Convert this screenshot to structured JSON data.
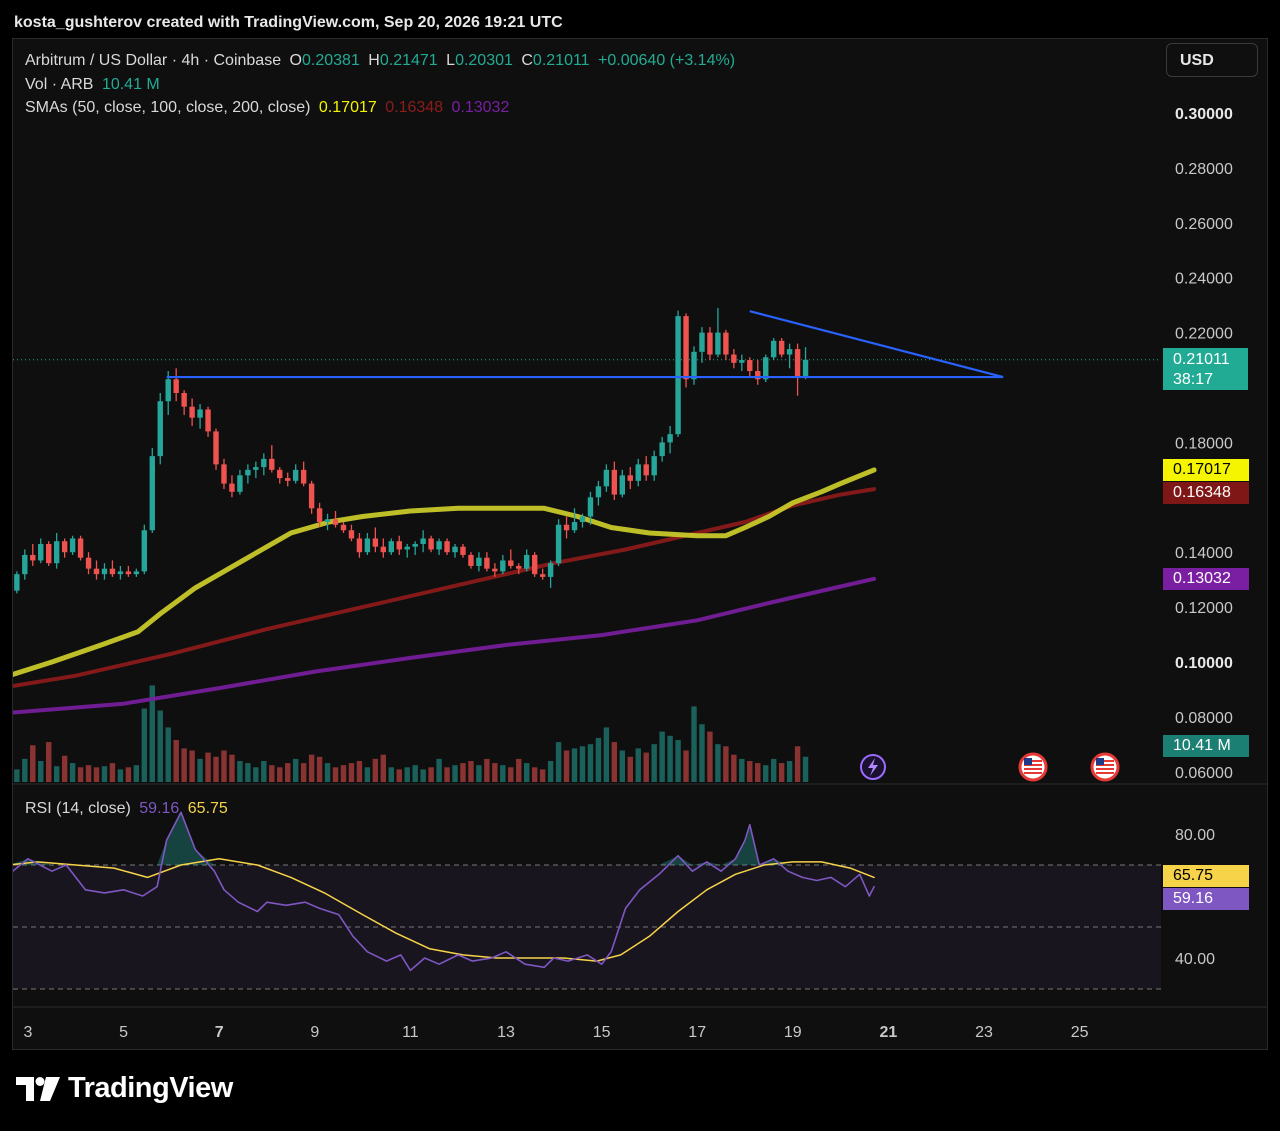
{
  "header": {
    "attribution": "kosta_gushterov created with TradingView.com, Sep 20, 2026 19:21 UTC"
  },
  "legend": {
    "symbol": "Arbitrum / US Dollar · 4h · Coinbase",
    "o_label": "O",
    "o_value": "0.20381",
    "h_label": "H",
    "h_value": "0.21471",
    "l_label": "L",
    "l_value": "0.20301",
    "c_label": "C",
    "c_value": "0.21011",
    "change": "+0.00640 (+3.14%)",
    "vol_label": "Vol · ARB",
    "vol_value": "10.41 M",
    "sma_label": "SMAs (50, close, 100, close, 200, close)",
    "sma50_value": "0.17017",
    "sma100_value": "0.16348",
    "sma200_value": "0.13032",
    "rsi_label": "RSI (14, close)",
    "rsi_value": "59.16",
    "rsi_ma_value": "65.75"
  },
  "toolbar": {
    "currency_label": "USD"
  },
  "price_badges": {
    "last_price": "0.21011",
    "countdown": "38:17",
    "sma50": "0.17017",
    "sma100": "0.16348",
    "sma200": "0.13032",
    "volume": "10.41 M",
    "rsi_ma": "65.75",
    "rsi": "59.16"
  },
  "icons": {
    "flash": "lightning-bolt-icon",
    "flag1": "us-flag-icon",
    "flag2": "us-flag-icon"
  },
  "colors": {
    "up": "#26a69a",
    "down": "#ef5350",
    "sma50": "#e6e600",
    "sma100": "#8b1a1a",
    "sma200": "#7b1fa2",
    "trendline": "#2962ff",
    "rsi": "#7e57c2",
    "rsi_ma": "#f7d34a"
  },
  "branding": {
    "logo_text": "TradingView"
  },
  "chart_data": {
    "type": "candlestick",
    "symbol": "ARB/USD",
    "timeframe": "4h",
    "x_ticks": [
      "3",
      "5",
      "7",
      "9",
      "11",
      "13",
      "15",
      "17",
      "19",
      "21",
      "23",
      "25"
    ],
    "y_ticks": [
      "0.30000",
      "0.28000",
      "0.26000",
      "0.24000",
      "0.22000",
      "0.18000",
      "0.14000",
      "0.12000",
      "0.10000",
      "0.08000",
      "0.06000"
    ],
    "ylim": [
      0.06,
      0.3
    ],
    "rsi_ticks": [
      "80.00",
      "40.00"
    ],
    "rsi_ylim": [
      30,
      90
    ],
    "rsi_bands": [
      70,
      50,
      30
    ],
    "day_start": 2.6,
    "candles_per_day": 6,
    "candles": [
      [
        0.124,
        0.128,
        0.121,
        0.126
      ],
      [
        0.126,
        0.133,
        0.125,
        0.132
      ],
      [
        0.132,
        0.141,
        0.13,
        0.139
      ],
      [
        0.139,
        0.143,
        0.135,
        0.137
      ],
      [
        0.137,
        0.145,
        0.136,
        0.143
      ],
      [
        0.143,
        0.144,
        0.135,
        0.136
      ],
      [
        0.136,
        0.147,
        0.134,
        0.144
      ],
      [
        0.144,
        0.145,
        0.138,
        0.14
      ],
      [
        0.14,
        0.146,
        0.139,
        0.145
      ],
      [
        0.145,
        0.146,
        0.137,
        0.138
      ],
      [
        0.138,
        0.14,
        0.132,
        0.134
      ],
      [
        0.134,
        0.137,
        0.13,
        0.132
      ],
      [
        0.132,
        0.136,
        0.13,
        0.134
      ],
      [
        0.134,
        0.137,
        0.131,
        0.132
      ],
      [
        0.132,
        0.135,
        0.13,
        0.133
      ],
      [
        0.133,
        0.135,
        0.131,
        0.132
      ],
      [
        0.132,
        0.134,
        0.131,
        0.133
      ],
      [
        0.133,
        0.15,
        0.132,
        0.148
      ],
      [
        0.148,
        0.178,
        0.147,
        0.175
      ],
      [
        0.175,
        0.198,
        0.172,
        0.195
      ],
      [
        0.195,
        0.206,
        0.19,
        0.203
      ],
      [
        0.203,
        0.207,
        0.195,
        0.198
      ],
      [
        0.198,
        0.199,
        0.19,
        0.193
      ],
      [
        0.193,
        0.196,
        0.186,
        0.189
      ],
      [
        0.189,
        0.194,
        0.185,
        0.192
      ],
      [
        0.192,
        0.193,
        0.182,
        0.184
      ],
      [
        0.184,
        0.185,
        0.17,
        0.172
      ],
      [
        0.172,
        0.174,
        0.163,
        0.165
      ],
      [
        0.165,
        0.168,
        0.16,
        0.162
      ],
      [
        0.162,
        0.17,
        0.161,
        0.168
      ],
      [
        0.168,
        0.172,
        0.165,
        0.17
      ],
      [
        0.17,
        0.173,
        0.167,
        0.171
      ],
      [
        0.171,
        0.176,
        0.168,
        0.174
      ],
      [
        0.174,
        0.179,
        0.169,
        0.17
      ],
      [
        0.17,
        0.171,
        0.165,
        0.167
      ],
      [
        0.167,
        0.169,
        0.164,
        0.166
      ],
      [
        0.166,
        0.172,
        0.165,
        0.17
      ],
      [
        0.17,
        0.173,
        0.164,
        0.165
      ],
      [
        0.165,
        0.166,
        0.154,
        0.156
      ],
      [
        0.156,
        0.158,
        0.149,
        0.151
      ],
      [
        0.151,
        0.154,
        0.148,
        0.152
      ],
      [
        0.152,
        0.155,
        0.149,
        0.15
      ],
      [
        0.15,
        0.151,
        0.147,
        0.148
      ],
      [
        0.148,
        0.15,
        0.144,
        0.145
      ],
      [
        0.145,
        0.147,
        0.138,
        0.14
      ],
      [
        0.14,
        0.147,
        0.139,
        0.145
      ],
      [
        0.145,
        0.149,
        0.14,
        0.142
      ],
      [
        0.142,
        0.145,
        0.138,
        0.14
      ],
      [
        0.14,
        0.145,
        0.139,
        0.144
      ],
      [
        0.144,
        0.146,
        0.139,
        0.141
      ],
      [
        0.141,
        0.143,
        0.138,
        0.142
      ],
      [
        0.142,
        0.144,
        0.139,
        0.143
      ],
      [
        0.143,
        0.148,
        0.14,
        0.145
      ],
      [
        0.145,
        0.146,
        0.14,
        0.141
      ],
      [
        0.141,
        0.145,
        0.139,
        0.144
      ],
      [
        0.144,
        0.145,
        0.139,
        0.14
      ],
      [
        0.14,
        0.143,
        0.138,
        0.142
      ],
      [
        0.142,
        0.143,
        0.138,
        0.139
      ],
      [
        0.139,
        0.14,
        0.134,
        0.135
      ],
      [
        0.135,
        0.14,
        0.133,
        0.138
      ],
      [
        0.138,
        0.14,
        0.133,
        0.134
      ],
      [
        0.134,
        0.136,
        0.131,
        0.133
      ],
      [
        0.133,
        0.139,
        0.132,
        0.137
      ],
      [
        0.137,
        0.141,
        0.134,
        0.135
      ],
      [
        0.135,
        0.136,
        0.132,
        0.134
      ],
      [
        0.134,
        0.141,
        0.133,
        0.139
      ],
      [
        0.139,
        0.14,
        0.131,
        0.132
      ],
      [
        0.132,
        0.134,
        0.13,
        0.131
      ],
      [
        0.131,
        0.137,
        0.127,
        0.136
      ],
      [
        0.136,
        0.152,
        0.135,
        0.15
      ],
      [
        0.15,
        0.153,
        0.145,
        0.148
      ],
      [
        0.148,
        0.156,
        0.147,
        0.151
      ],
      [
        0.151,
        0.154,
        0.149,
        0.153
      ],
      [
        0.153,
        0.162,
        0.15,
        0.16
      ],
      [
        0.16,
        0.166,
        0.157,
        0.164
      ],
      [
        0.164,
        0.172,
        0.162,
        0.17
      ],
      [
        0.17,
        0.173,
        0.159,
        0.161
      ],
      [
        0.161,
        0.17,
        0.16,
        0.168
      ],
      [
        0.168,
        0.171,
        0.163,
        0.166
      ],
      [
        0.166,
        0.174,
        0.164,
        0.172
      ],
      [
        0.172,
        0.175,
        0.166,
        0.168
      ],
      [
        0.168,
        0.177,
        0.166,
        0.175
      ],
      [
        0.175,
        0.182,
        0.173,
        0.18
      ],
      [
        0.18,
        0.186,
        0.176,
        0.183
      ],
      [
        0.183,
        0.228,
        0.182,
        0.226
      ],
      [
        0.226,
        0.227,
        0.2,
        0.203
      ],
      [
        0.203,
        0.215,
        0.201,
        0.213
      ],
      [
        0.213,
        0.222,
        0.209,
        0.22
      ],
      [
        0.22,
        0.222,
        0.21,
        0.212
      ],
      [
        0.212,
        0.229,
        0.211,
        0.22
      ],
      [
        0.22,
        0.221,
        0.21,
        0.212
      ],
      [
        0.212,
        0.214,
        0.207,
        0.209
      ],
      [
        0.209,
        0.212,
        0.206,
        0.21
      ],
      [
        0.21,
        0.211,
        0.204,
        0.206
      ],
      [
        0.206,
        0.21,
        0.201,
        0.203
      ],
      [
        0.203,
        0.212,
        0.202,
        0.211
      ],
      [
        0.211,
        0.218,
        0.21,
        0.217
      ],
      [
        0.217,
        0.218,
        0.211,
        0.212
      ],
      [
        0.212,
        0.216,
        0.207,
        0.214
      ],
      [
        0.214,
        0.216,
        0.197,
        0.204
      ],
      [
        0.2038,
        0.2147,
        0.203,
        0.2101
      ]
    ],
    "volume": [
      18,
      12,
      22,
      35,
      20,
      38,
      15,
      25,
      18,
      14,
      16,
      14,
      15,
      18,
      12,
      14,
      16,
      70,
      92,
      68,
      52,
      40,
      32,
      30,
      22,
      28,
      24,
      30,
      26,
      20,
      18,
      14,
      20,
      16,
      14,
      18,
      22,
      18,
      26,
      24,
      18,
      14,
      16,
      18,
      20,
      14,
      22,
      26,
      14,
      12,
      14,
      16,
      12,
      14,
      22,
      14,
      16,
      18,
      20,
      16,
      22,
      18,
      16,
      14,
      22,
      18,
      14,
      12,
      20,
      38,
      30,
      32,
      34,
      36,
      42,
      52,
      38,
      30,
      24,
      32,
      28,
      36,
      48,
      44,
      40,
      30,
      72,
      55,
      48,
      36,
      34,
      26,
      22,
      20,
      18,
      16,
      22,
      18,
      20,
      34,
      24,
      14,
      10
    ],
    "sma50": [
      [
        2.6,
        0.095
      ],
      [
        3.5,
        0.1
      ],
      [
        4.5,
        0.106
      ],
      [
        5.3,
        0.111
      ],
      [
        5.8,
        0.118
      ],
      [
        6.5,
        0.127
      ],
      [
        7.5,
        0.137
      ],
      [
        8.5,
        0.147
      ],
      [
        9.3,
        0.151
      ],
      [
        10.0,
        0.153
      ],
      [
        11.0,
        0.155
      ],
      [
        12.0,
        0.156
      ],
      [
        13.0,
        0.156
      ],
      [
        13.8,
        0.156
      ],
      [
        14.5,
        0.153
      ],
      [
        15.2,
        0.149
      ],
      [
        16.0,
        0.147
      ],
      [
        17.0,
        0.146
      ],
      [
        17.6,
        0.146
      ],
      [
        18.0,
        0.149
      ],
      [
        18.5,
        0.153
      ],
      [
        19.0,
        0.158
      ],
      [
        19.6,
        0.162
      ],
      [
        20.0,
        0.165
      ],
      [
        20.7,
        0.17
      ]
    ],
    "sma100": [
      [
        2.6,
        0.091
      ],
      [
        4.0,
        0.095
      ],
      [
        6.0,
        0.103
      ],
      [
        8.0,
        0.112
      ],
      [
        10.0,
        0.12
      ],
      [
        12.0,
        0.128
      ],
      [
        14.0,
        0.136
      ],
      [
        15.5,
        0.141
      ],
      [
        17.0,
        0.147
      ],
      [
        18.0,
        0.151
      ],
      [
        19.0,
        0.157
      ],
      [
        20.0,
        0.161
      ],
      [
        20.7,
        0.163
      ]
    ],
    "sma200": [
      [
        2.6,
        0.0815
      ],
      [
        5.0,
        0.0848
      ],
      [
        7.0,
        0.0905
      ],
      [
        9.0,
        0.0965
      ],
      [
        11.0,
        0.1015
      ],
      [
        13.0,
        0.1062
      ],
      [
        15.0,
        0.1098
      ],
      [
        17.0,
        0.1152
      ],
      [
        18.5,
        0.1215
      ],
      [
        20.0,
        0.1275
      ],
      [
        20.7,
        0.1303
      ]
    ],
    "rsi": [
      [
        2.6,
        67
      ],
      [
        3.0,
        72
      ],
      [
        3.5,
        68
      ],
      [
        3.8,
        70
      ],
      [
        4.2,
        62
      ],
      [
        4.6,
        61
      ],
      [
        5.0,
        62
      ],
      [
        5.4,
        60
      ],
      [
        5.7,
        63
      ],
      [
        5.9,
        78
      ],
      [
        6.2,
        87
      ],
      [
        6.5,
        75
      ],
      [
        6.9,
        68
      ],
      [
        7.1,
        62
      ],
      [
        7.4,
        58
      ],
      [
        7.8,
        55
      ],
      [
        8.0,
        58
      ],
      [
        8.4,
        57
      ],
      [
        8.8,
        58
      ],
      [
        9.1,
        56
      ],
      [
        9.5,
        54
      ],
      [
        9.8,
        47
      ],
      [
        10.1,
        42
      ],
      [
        10.5,
        39
      ],
      [
        10.8,
        41
      ],
      [
        11.0,
        36
      ],
      [
        11.3,
        40
      ],
      [
        11.6,
        38
      ],
      [
        12.0,
        41
      ],
      [
        12.3,
        39
      ],
      [
        12.7,
        40
      ],
      [
        13.0,
        42
      ],
      [
        13.4,
        38
      ],
      [
        13.8,
        37
      ],
      [
        14.0,
        40
      ],
      [
        14.3,
        39
      ],
      [
        14.7,
        41
      ],
      [
        15.0,
        38
      ],
      [
        15.2,
        42
      ],
      [
        15.5,
        56
      ],
      [
        15.8,
        62
      ],
      [
        16.2,
        67
      ],
      [
        16.6,
        73
      ],
      [
        16.9,
        68
      ],
      [
        17.2,
        71
      ],
      [
        17.5,
        68
      ],
      [
        17.8,
        72
      ],
      [
        18.0,
        78
      ],
      [
        18.1,
        83
      ],
      [
        18.3,
        70
      ],
      [
        18.6,
        72
      ],
      [
        18.9,
        68
      ],
      [
        19.2,
        66
      ],
      [
        19.5,
        65
      ],
      [
        19.8,
        66
      ],
      [
        20.1,
        63
      ],
      [
        20.4,
        67
      ],
      [
        20.6,
        60
      ],
      [
        20.7,
        63
      ]
    ],
    "rsi_ma": [
      [
        2.6,
        70
      ],
      [
        3.2,
        71
      ],
      [
        4.0,
        70
      ],
      [
        4.8,
        69
      ],
      [
        5.5,
        66
      ],
      [
        6.2,
        70
      ],
      [
        7.0,
        72
      ],
      [
        7.8,
        70
      ],
      [
        8.5,
        66
      ],
      [
        9.2,
        61
      ],
      [
        10.0,
        54
      ],
      [
        10.7,
        48
      ],
      [
        11.4,
        43
      ],
      [
        12.1,
        41
      ],
      [
        12.8,
        40
      ],
      [
        13.5,
        40
      ],
      [
        14.2,
        40
      ],
      [
        14.9,
        39
      ],
      [
        15.4,
        41
      ],
      [
        16.0,
        47
      ],
      [
        16.6,
        55
      ],
      [
        17.2,
        62
      ],
      [
        17.8,
        67
      ],
      [
        18.4,
        70
      ],
      [
        19.0,
        71
      ],
      [
        19.6,
        71
      ],
      [
        20.2,
        69
      ],
      [
        20.7,
        66
      ]
    ],
    "trendline_horizontal": [
      [
        5.9,
        0.2038
      ],
      [
        23.4,
        0.2038
      ]
    ],
    "trendline_descending": [
      [
        18.1,
        0.2278
      ],
      [
        23.4,
        0.2038
      ]
    ],
    "current_price": 0.21011
  }
}
